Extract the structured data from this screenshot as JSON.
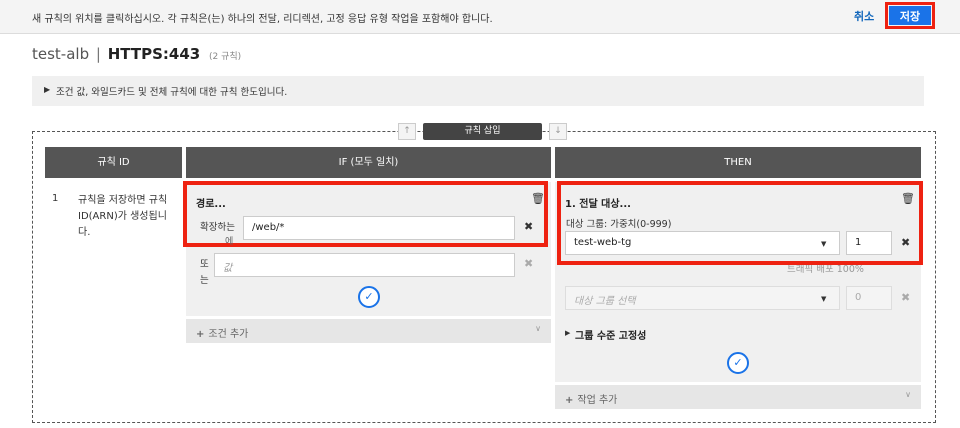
{
  "topbar": {
    "message": "새 규칙의 위치를 클릭하십시오. 각 규칙은(는) 하나의 전달, 리디렉션, 고정 응답 유형 작업을 포함해야 합니다.",
    "cancel_label": "취소",
    "save_label": "저장"
  },
  "header": {
    "lb_name": "test-alb",
    "separator": "|",
    "listener": "HTTPS:443",
    "rule_count": "(2 규칙)"
  },
  "info": {
    "text": "조건 값, 와일드카드 및 전체 규칙에 대한 규칙 한도입니다."
  },
  "insert": {
    "label": "규칙 삽입",
    "up_arrow": "↑",
    "down_arrow": "↓"
  },
  "columns": {
    "rule_id": "규칙 ID",
    "if": "IF (모두 일치)",
    "then": "THEN"
  },
  "rule": {
    "number": "1",
    "note": "규칙을 저장하면 규칙 ID(ARN)가 생성됩니다."
  },
  "condition": {
    "title": "경로...",
    "row1_label": "확장하는",
    "row1_label_cont": "에",
    "row1_value": "/web/*",
    "row2_label": "또",
    "row2_label_cont": "는",
    "row2_placeholder": "값",
    "add_condition": "조건 추가"
  },
  "action": {
    "title": "1. 전달 대상...",
    "subtitle": "대상 그룹: 가중치(0-999)",
    "target_group": "test-web-tg",
    "weight": "1",
    "traffic_note": "트래픽 배포 100%",
    "target_group_placeholder": "대상 그룹 선택",
    "weight2": "0",
    "stickiness": "그룹 수준 고정성",
    "add_action": "작업 추가"
  },
  "colors": {
    "accent_blue": "#1a73e8",
    "highlight_red": "#ee2211",
    "header_gray": "#555555"
  },
  "icons": {
    "trash": "trash-icon",
    "close": "close-icon",
    "check": "check-icon",
    "plus": "plus-icon",
    "chevron": "chevron-down-icon",
    "triangle": "expand-triangle-icon"
  }
}
